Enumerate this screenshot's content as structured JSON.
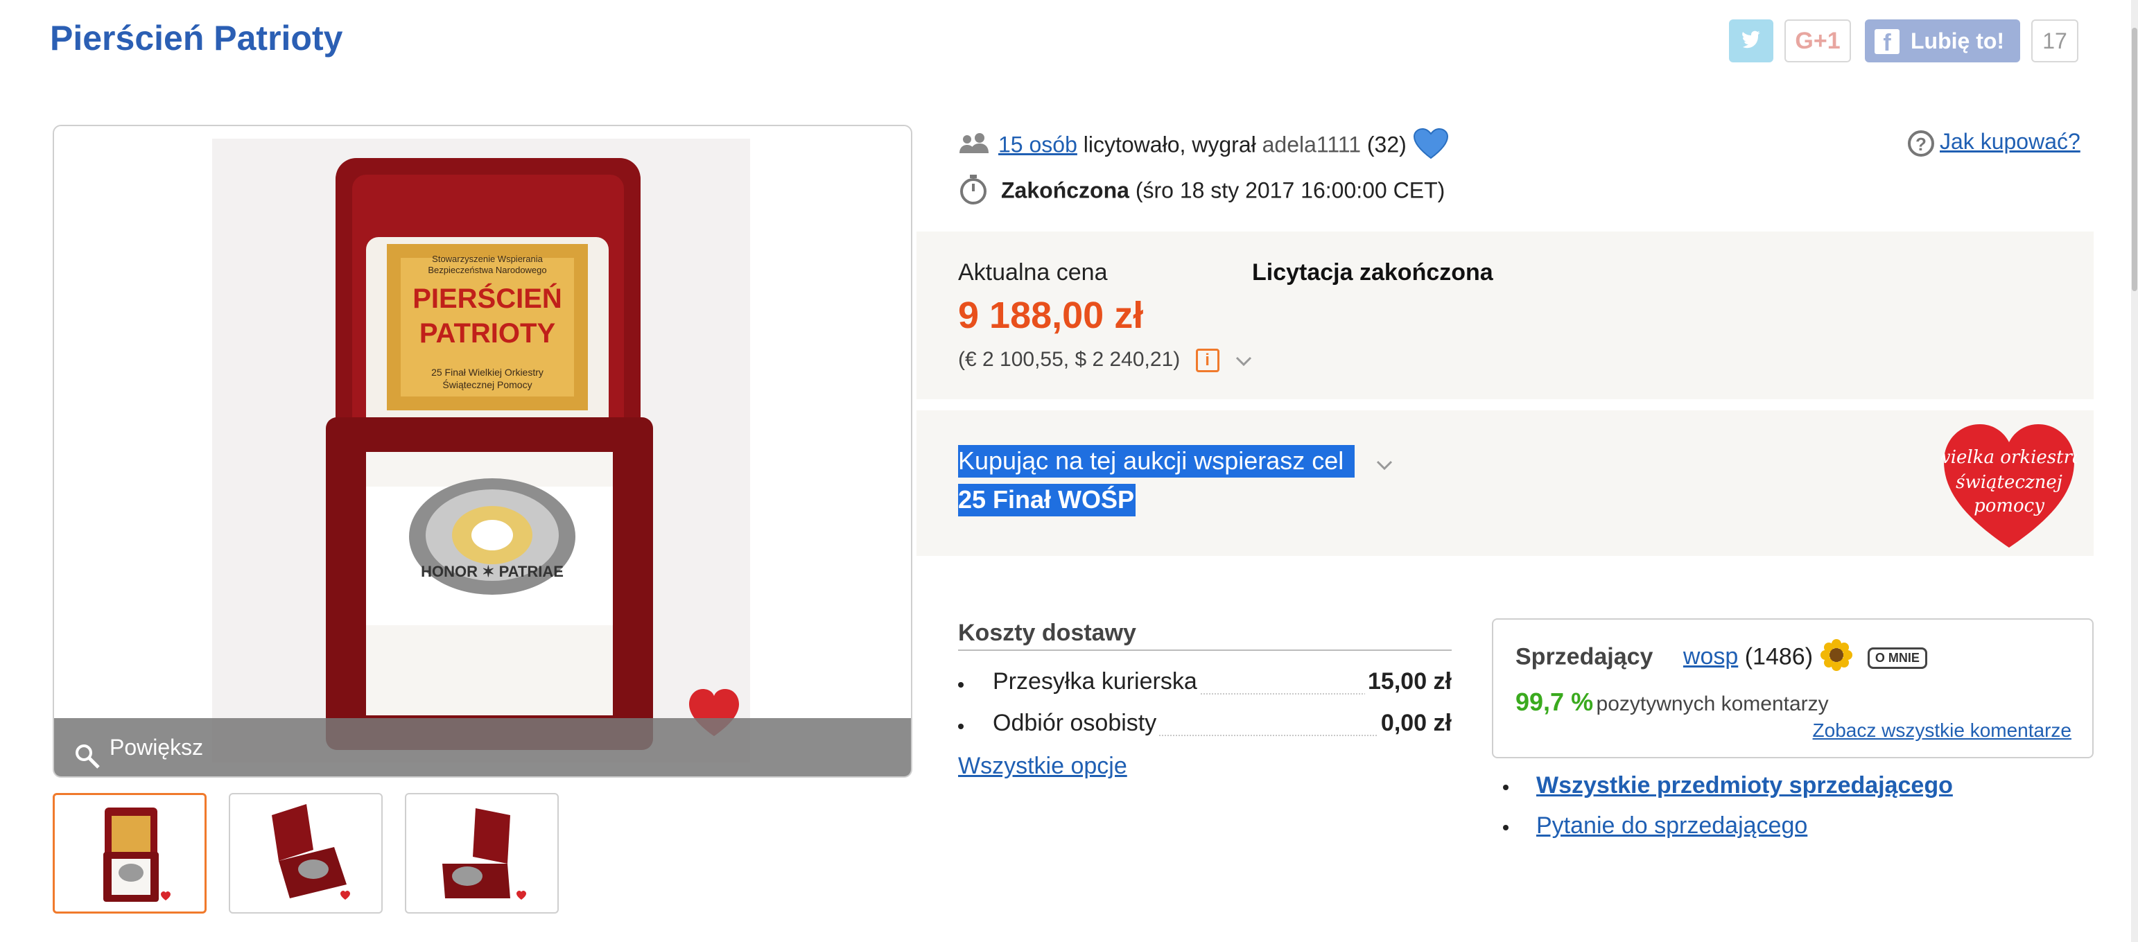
{
  "header": {
    "title": "Pierścień Patrioty",
    "twitter_icon": "twitter-icon",
    "gplus_label": "G+1",
    "facebook_label": "Lubię to!",
    "facebook_count": "17"
  },
  "gallery": {
    "zoom_label": "Powiększ",
    "box_text_line1": "Stowarzyszenie Wspierania",
    "box_text_line2": "Bezpieczeństwa Narodowego",
    "box_title_line1": "PIERŚCIEŃ",
    "box_title_line2": "PATRIOTY",
    "box_sub_line1": "25 Finał Wielkiej Orkiestry",
    "box_sub_line2": "Świątecznej Pomocy",
    "ring_text": "HONOR ✶ PATRIAE",
    "thumbnails": [
      "thumb-1",
      "thumb-2",
      "thumb-3"
    ]
  },
  "auction": {
    "bidders_link": "15 osób",
    "bidders_text": "licytowało, wygrał",
    "winner": "adela1111",
    "winner_score": "(32)",
    "status": "Zakończona",
    "end_date": "(śro 18 sty 2017 16:00:00 CET)",
    "how_to_buy": "Jak kupować?"
  },
  "price": {
    "label": "Aktualna cena",
    "status": "Licytacja zakończona",
    "amount": "9 188,00 zł",
    "converted": "(€ 2 100,55, $ 2 240,21)"
  },
  "cause": {
    "line1": "Kupując na tej aukcji wspierasz cel",
    "line2": "25 Finał WOŚP",
    "logo_line1": "wielka orkiestra",
    "logo_line2": "świątecznej",
    "logo_line3": "pomocy"
  },
  "shipping": {
    "title": "Koszty dostawy",
    "options": [
      {
        "name": "Przesyłka kurierska",
        "price": "15,00 zł"
      },
      {
        "name": "Odbiór osobisty",
        "price": "0,00 zł"
      }
    ],
    "all_options": "Wszystkie opcje"
  },
  "seller": {
    "label": "Sprzedający",
    "name": "wosp",
    "score": "(1486)",
    "about_badge": "O MNIE",
    "positive_pct": "99,7 %",
    "positive_text": "pozytywnych komentarzy",
    "all_comments": "Zobacz wszystkie komentarze",
    "all_items": "Wszystkie przedmioty sprzedającego",
    "ask_seller": "Pytanie do sprzedającego"
  },
  "colors": {
    "title": "#2b5fb4",
    "price": "#e8501c",
    "link": "#1f5fb3",
    "selection": "#1f6fe0",
    "positive": "#3aaa1e",
    "active_thumb": "#f07a2c"
  }
}
